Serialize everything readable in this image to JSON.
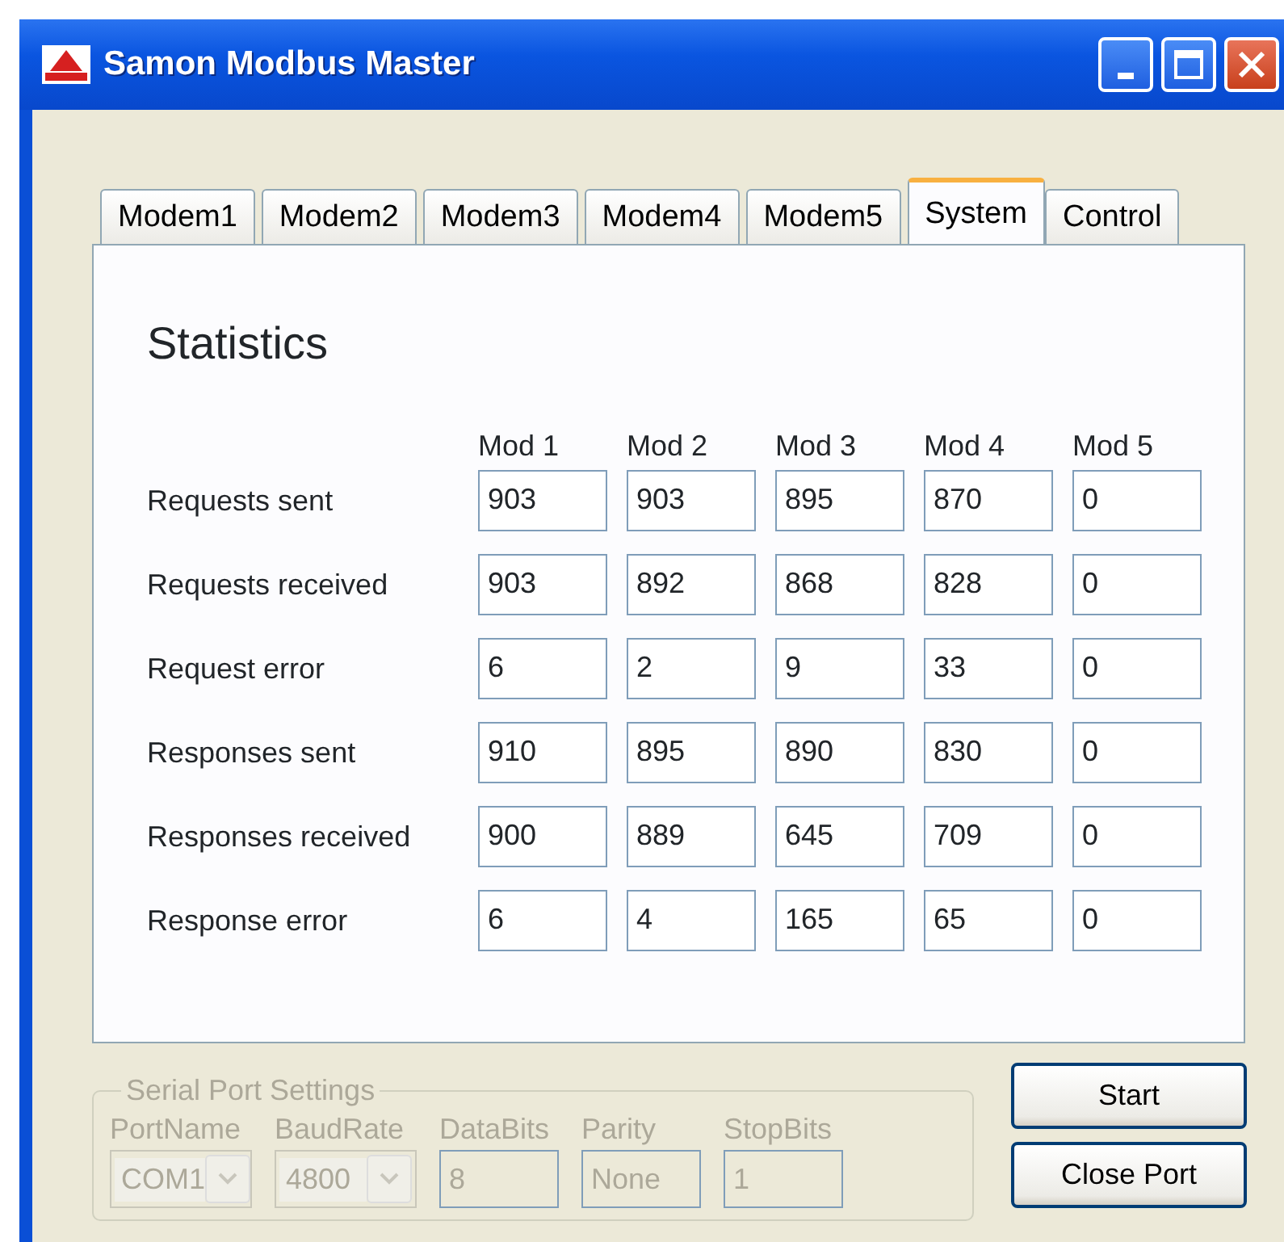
{
  "window": {
    "title": "Samon Modbus Master"
  },
  "tabs": [
    {
      "label": "Modem1",
      "selected": false
    },
    {
      "label": "Modem2",
      "selected": false
    },
    {
      "label": "Modem3",
      "selected": false
    },
    {
      "label": "Modem4",
      "selected": false
    },
    {
      "label": "Modem5",
      "selected": false
    },
    {
      "label": "System",
      "selected": true
    },
    {
      "label": "Control",
      "selected": false
    }
  ],
  "statistics": {
    "title": "Statistics",
    "columns": [
      "Mod 1",
      "Mod 2",
      "Mod 3",
      "Mod 4",
      "Mod 5"
    ],
    "rows": [
      {
        "label": "Requests sent",
        "values": [
          "903",
          "903",
          "895",
          "870",
          "0"
        ]
      },
      {
        "label": "Requests received",
        "values": [
          "903",
          "892",
          "868",
          "828",
          "0"
        ]
      },
      {
        "label": "Request error",
        "values": [
          "6",
          "2",
          "9",
          "33",
          "0"
        ]
      },
      {
        "label": "Responses sent",
        "values": [
          "910",
          "895",
          "890",
          "830",
          "0"
        ]
      },
      {
        "label": "Responses received",
        "values": [
          "900",
          "889",
          "645",
          "709",
          "0"
        ]
      },
      {
        "label": "Response error",
        "values": [
          "6",
          "4",
          "165",
          "65",
          "0"
        ]
      }
    ]
  },
  "serial_port": {
    "title": "Serial Port Settings",
    "disabled": true,
    "fields": [
      {
        "label": "PortName",
        "kind": "combo",
        "value": "COM1"
      },
      {
        "label": "BaudRate",
        "kind": "combo",
        "value": "4800"
      },
      {
        "label": "DataBits",
        "kind": "text",
        "value": "8"
      },
      {
        "label": "Parity",
        "kind": "text",
        "value": "None"
      },
      {
        "label": "StopBits",
        "kind": "text",
        "value": "1"
      }
    ]
  },
  "buttons": [
    "Start",
    "Close Port"
  ]
}
